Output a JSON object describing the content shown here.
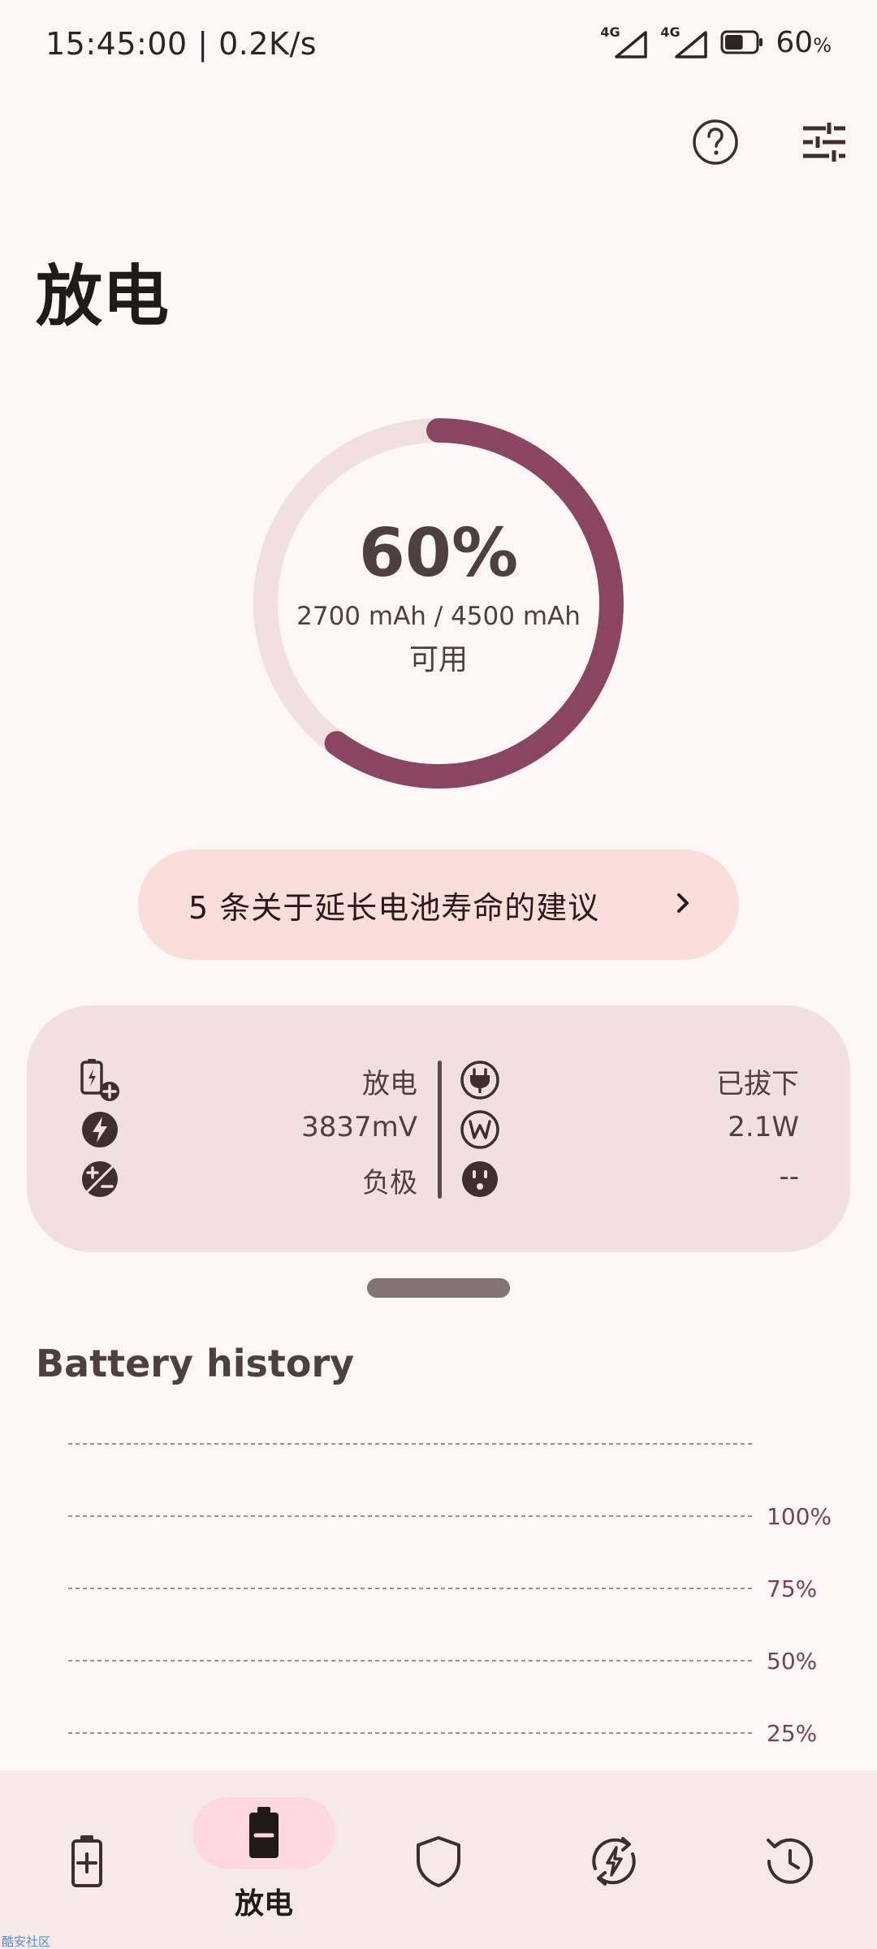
{
  "status_bar": {
    "time": "15:45:00 | 0.2K/s",
    "signal1_label": "4G",
    "signal2_label": "4G",
    "battery_level": 0.6,
    "battery_text": "60",
    "battery_unit": "%"
  },
  "header": {
    "help_icon": "help-circle-icon",
    "settings_icon": "tune-sliders-icon",
    "title": "放电"
  },
  "battery": {
    "percent_text": "60%",
    "level": 0.6,
    "mah_text": "2700 mAh / 4500 mAh",
    "available_label": "可用",
    "ring_color": "#8A4560",
    "ring_track_color": "#F2DFE2"
  },
  "tips": {
    "label": "5 条关于延长电池寿命的建议",
    "chevron": "›"
  },
  "info": {
    "left": [
      {
        "icon": "battery-charge-add-icon",
        "value": "放电"
      },
      {
        "icon": "bolt-circle-icon",
        "value": "3837mV"
      },
      {
        "icon": "plus-minus-circle-icon",
        "value": "负极"
      }
    ],
    "right": [
      {
        "icon": "plug-circle-icon",
        "value": "已拔下"
      },
      {
        "icon": "watt-circle-icon",
        "value": "2.1W"
      },
      {
        "icon": "outlet-icon",
        "value": "--"
      }
    ]
  },
  "history": {
    "title": "Battery history"
  },
  "chart_data": {
    "type": "line",
    "title": "",
    "y_tick_labels": [
      "100%",
      "75%",
      "50%",
      "25%"
    ],
    "y_ticks": [
      100,
      75,
      50,
      25
    ],
    "series": [],
    "grid": true,
    "tick_color": "#7A3F5A"
  },
  "nav": {
    "items": [
      {
        "icon": "battery-plus-icon",
        "label": ""
      },
      {
        "icon": "battery-minus-icon",
        "label": "放电",
        "active": true
      },
      {
        "icon": "shield-icon",
        "label": ""
      },
      {
        "icon": "sync-bolt-icon",
        "label": ""
      },
      {
        "icon": "history-clock-icon",
        "label": ""
      }
    ]
  },
  "watermark": "酷安社区"
}
